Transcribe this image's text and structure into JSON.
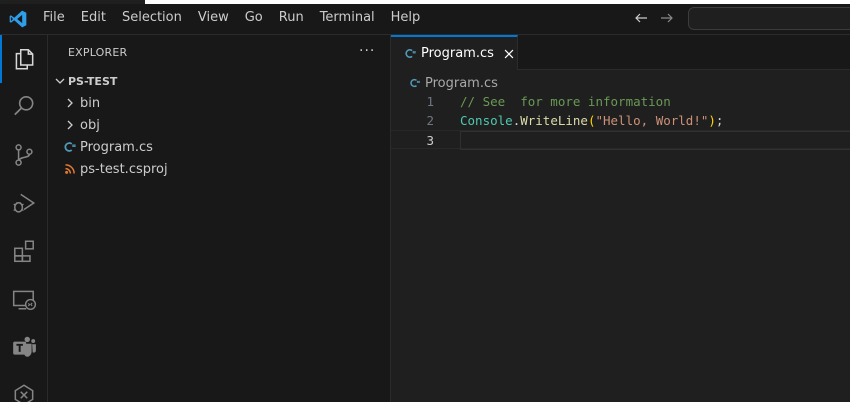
{
  "menu": [
    "File",
    "Edit",
    "Selection",
    "View",
    "Go",
    "Run",
    "Terminal",
    "Help"
  ],
  "activity_bar": [
    {
      "name": "explorer-icon",
      "active": true
    },
    {
      "name": "search-icon",
      "active": false
    },
    {
      "name": "source-control-icon",
      "active": false
    },
    {
      "name": "run-debug-icon",
      "active": false
    },
    {
      "name": "extensions-icon",
      "active": false
    },
    {
      "name": "remote-explorer-icon",
      "active": false
    },
    {
      "name": "teams-icon",
      "active": false
    },
    {
      "name": "power-platform-icon",
      "active": false
    }
  ],
  "sidebar": {
    "title": "EXPLORER",
    "more": "···",
    "folder": "PS-TEST",
    "items": [
      {
        "label": "bin",
        "kind": "folder"
      },
      {
        "label": "obj",
        "kind": "folder"
      },
      {
        "label": "Program.cs",
        "kind": "csharp"
      },
      {
        "label": "ps-test.csproj",
        "kind": "rss"
      }
    ]
  },
  "editor": {
    "tab_label": "Program.cs",
    "breadcrumb": "Program.cs",
    "lines": [
      {
        "num": "1",
        "comment": "// See  for more information"
      },
      {
        "num": "2",
        "class": "Console",
        "dot": ".",
        "method": "WriteLine",
        "open": "(",
        "string": "\"Hello, World!\"",
        "close": ")",
        "semi": ";"
      },
      {
        "num": "3"
      }
    ]
  },
  "colors": {
    "accent": "#0078d4",
    "csharp_icon": "#519aba",
    "rss_icon": "#e37933"
  }
}
